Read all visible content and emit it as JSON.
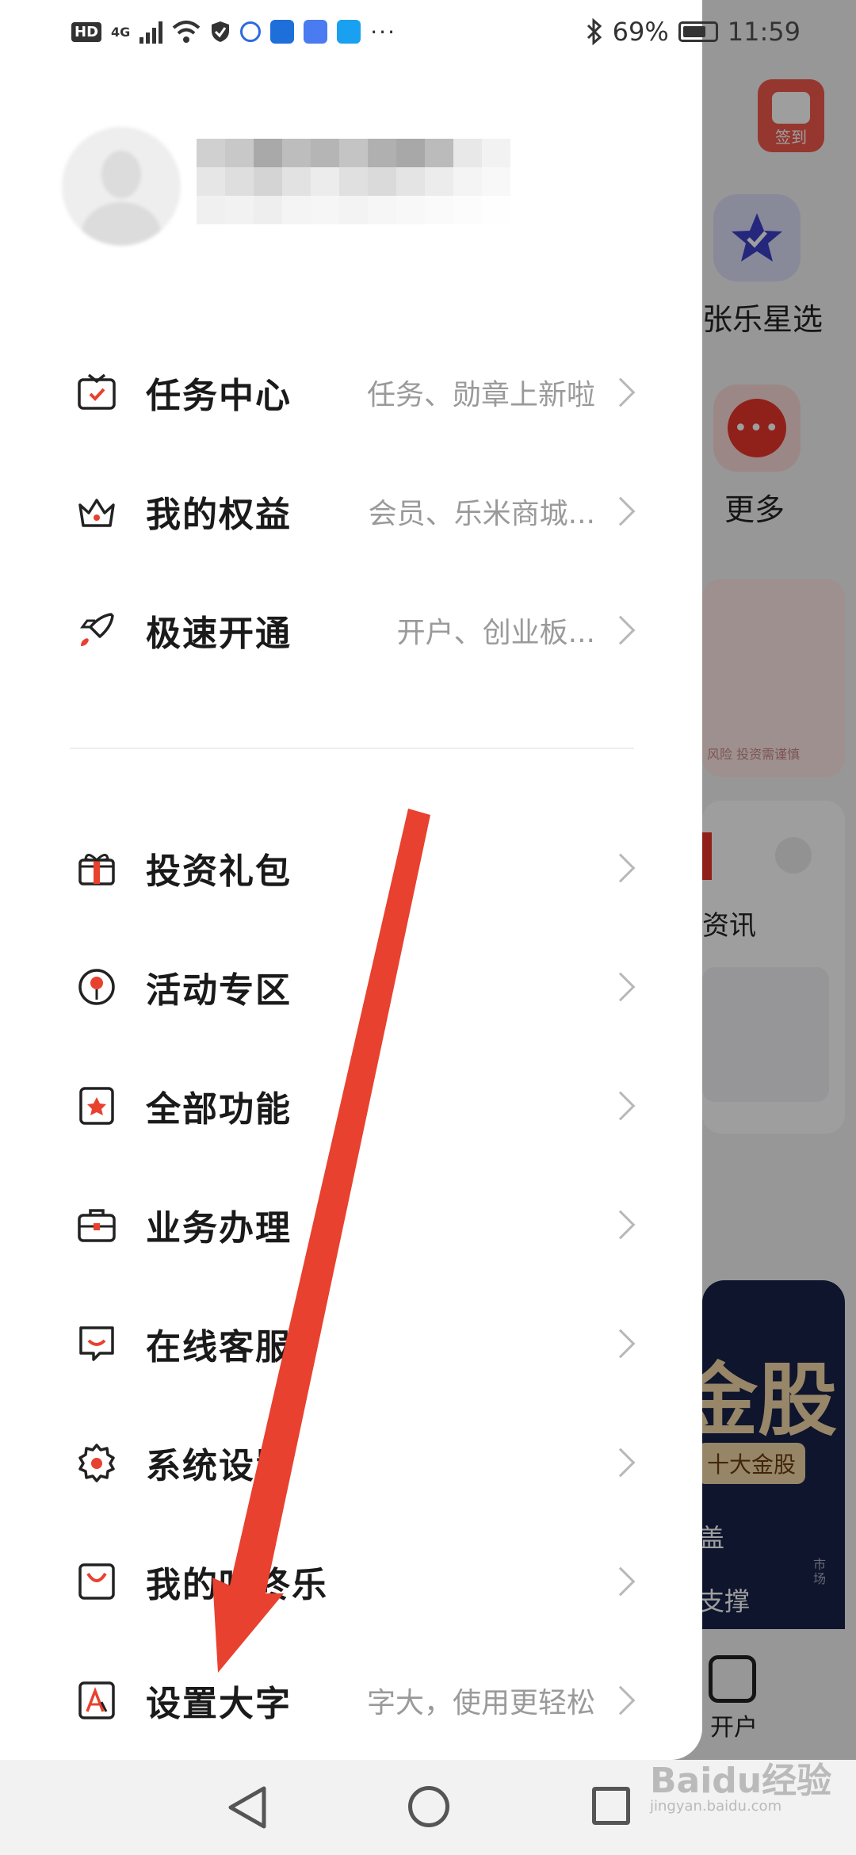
{
  "status_bar": {
    "hd": "HD",
    "network": "4G",
    "more": "···",
    "battery": "69%",
    "time": "11:59"
  },
  "background_app": {
    "checkin_label": "签到",
    "star_label": "张乐星选",
    "more_label": "更多",
    "card_fine_print": "风险 投资需谨慎",
    "news_label": "资讯",
    "banner_big": "金股",
    "banner_pill": "十大金股",
    "banner_line1": "盖",
    "banner_line2": "支撑",
    "banner_side": "市场",
    "open_account_label": "开户"
  },
  "drawer": {
    "menu_group1": [
      {
        "label": "任务中心",
        "hint": "任务、勋章上新啦",
        "icon": "task-icon"
      },
      {
        "label": "我的权益",
        "hint": "会员、乐米商城...",
        "icon": "crown-icon"
      },
      {
        "label": "极速开通",
        "hint": "开户、创业板...",
        "icon": "rocket-icon"
      }
    ],
    "menu_group2": [
      {
        "label": "投资礼包",
        "hint": "",
        "icon": "gift-icon"
      },
      {
        "label": "活动专区",
        "hint": "",
        "icon": "pin-icon"
      },
      {
        "label": "全部功能",
        "hint": "",
        "icon": "star-box-icon"
      },
      {
        "label": "业务办理",
        "hint": "",
        "icon": "briefcase-icon"
      },
      {
        "label": "在线客服",
        "hint": "",
        "icon": "chat-icon"
      },
      {
        "label": "系统设置",
        "hint": "",
        "icon": "gear-icon"
      },
      {
        "label": "我的咕咚乐",
        "hint": "",
        "icon": "smile-box-icon"
      },
      {
        "label": "设置大字",
        "hint": "字大，使用更轻松",
        "icon": "font-size-icon"
      }
    ]
  },
  "watermark": {
    "brand": "Baidu经验",
    "url": "jingyan.baidu.com"
  },
  "colors": {
    "accent": "#e8412f",
    "arrow": "#e8412f"
  }
}
